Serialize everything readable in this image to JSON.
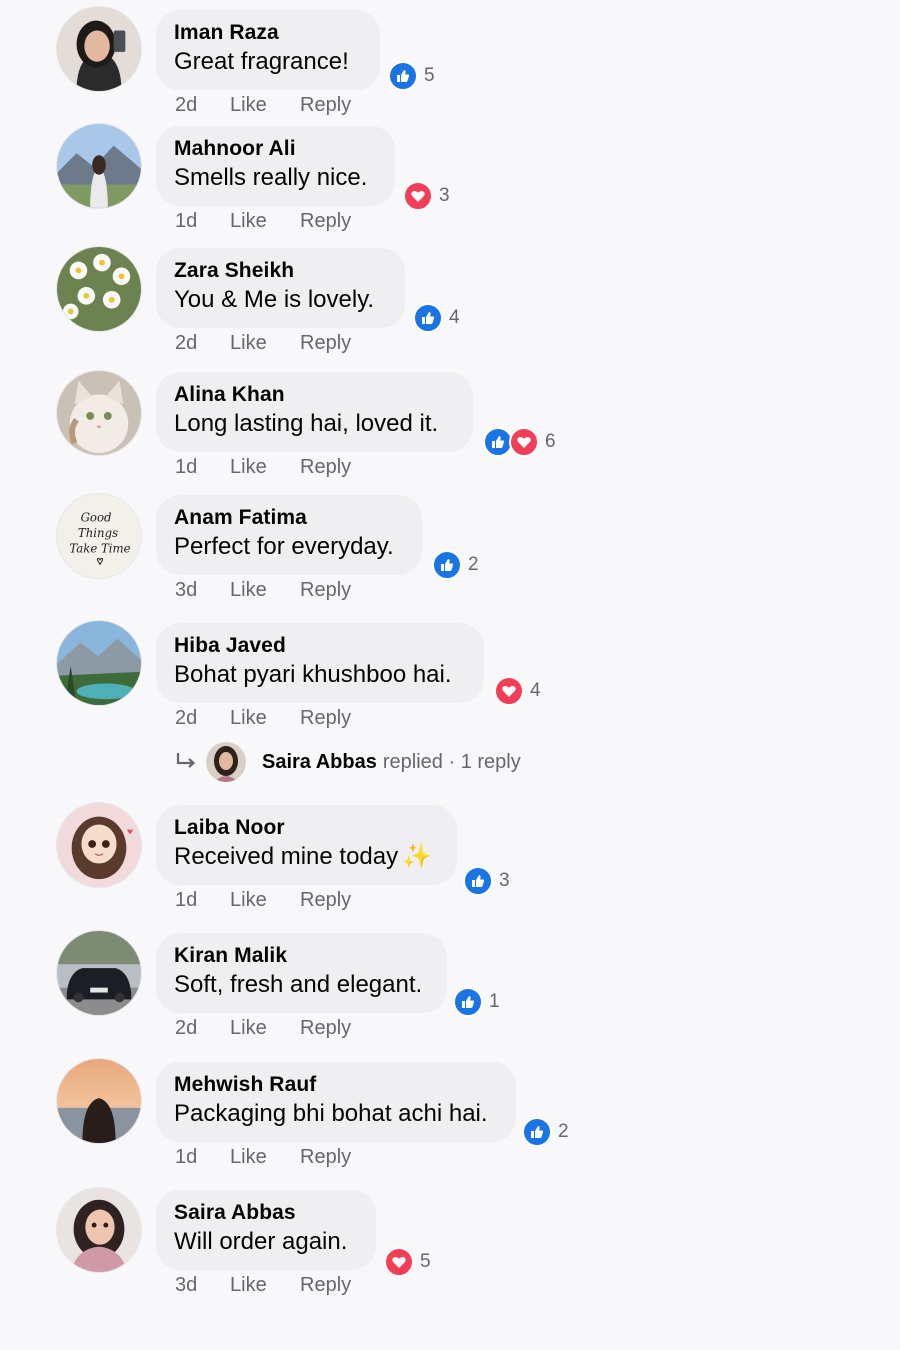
{
  "comments": [
    {
      "author": "Iman Raza",
      "text": "Great fragrance!",
      "time": "2d",
      "like": "Like",
      "reply": "Reply",
      "reactions": [
        "like"
      ],
      "count": "5"
    },
    {
      "author": "Mahnoor Ali",
      "text": "Smells really nice.",
      "time": "1d",
      "like": "Like",
      "reply": "Reply",
      "reactions": [
        "love"
      ],
      "count": "3"
    },
    {
      "author": "Zara Sheikh",
      "text": "You & Me is lovely.",
      "time": "2d",
      "like": "Like",
      "reply": "Reply",
      "reactions": [
        "like"
      ],
      "count": "4"
    },
    {
      "author": "Alina Khan",
      "text": "Long lasting hai, loved it.",
      "time": "1d",
      "like": "Like",
      "reply": "Reply",
      "reactions": [
        "like",
        "love"
      ],
      "count": "6"
    },
    {
      "author": "Anam Fatima",
      "text": "Perfect for everyday.",
      "time": "3d",
      "like": "Like",
      "reply": "Reply",
      "reactions": [
        "like"
      ],
      "count": "2",
      "avatar_text": [
        "Good",
        "Things",
        "Take Time"
      ]
    },
    {
      "author": "Hiba Javed",
      "text": "Bohat pyari khushboo hai.",
      "time": "2d",
      "like": "Like",
      "reply": "Reply",
      "reactions": [
        "love"
      ],
      "count": "4"
    },
    {
      "author": "Laiba Noor",
      "text": "Received mine today",
      "emoji": "✨",
      "time": "1d",
      "like": "Like",
      "reply": "Reply",
      "reactions": [
        "like"
      ],
      "count": "3"
    },
    {
      "author": "Kiran Malik",
      "text": "Soft, fresh and elegant.",
      "time": "2d",
      "like": "Like",
      "reply": "Reply",
      "reactions": [
        "like"
      ],
      "count": "1"
    },
    {
      "author": "Mehwish Rauf",
      "text": "Packaging bhi bohat achi hai.",
      "time": "1d",
      "like": "Like",
      "reply": "Reply",
      "reactions": [
        "like"
      ],
      "count": "2"
    },
    {
      "author": "Saira Abbas",
      "text": "Will order again.",
      "time": "3d",
      "like": "Like",
      "reply": "Reply",
      "reactions": [
        "love"
      ],
      "count": "5"
    }
  ],
  "reply_thread": {
    "author": "Saira Abbas",
    "action": "replied · 1 reply"
  },
  "colors": {
    "like": "#1b74e4",
    "love": "#f33e58",
    "meta": "#65676b",
    "bubble": "#efeff2"
  }
}
